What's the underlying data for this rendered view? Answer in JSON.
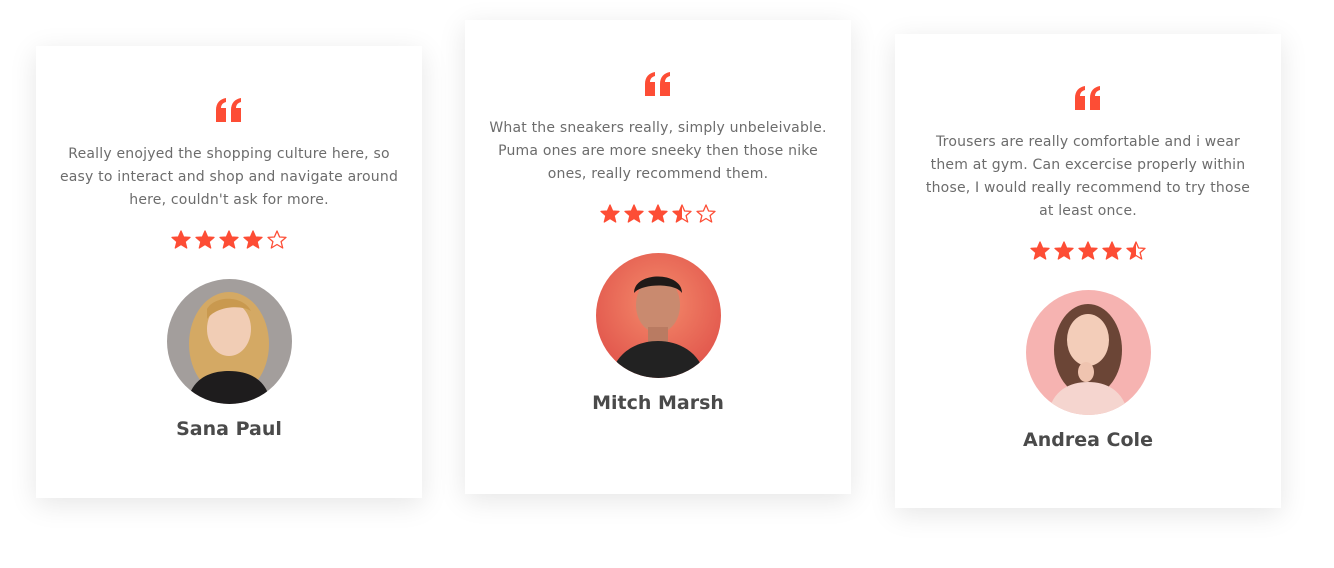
{
  "colors": {
    "accent": "#fd4d35",
    "text": "#6c6c6c",
    "name": "#4a4a4a",
    "card_bg": "#ffffff"
  },
  "testimonials": [
    {
      "quote_icon": "quote-icon",
      "text": "Really enojyed the shopping culture here, so easy to interact and shop and navigate around here, couldn't ask for more.",
      "rating": 4,
      "rating_max": 5,
      "name": "Sana Paul",
      "avatar": "woman-blonde-avatar"
    },
    {
      "quote_icon": "quote-icon",
      "text": "What the sneakers really, simply unbeleivable. Puma ones are more sneeky then those nike ones, really recommend them.",
      "rating": 3.5,
      "rating_max": 5,
      "name": "Mitch Marsh",
      "avatar": "man-dark-hair-avatar"
    },
    {
      "quote_icon": "quote-icon",
      "text": "Trousers are really comfortable and i wear them at gym. Can excercise properly within those, I would really recommend to try those at least once.",
      "rating": 4.5,
      "rating_max": 5,
      "name": "Andrea Cole",
      "avatar": "woman-brunette-avatar"
    }
  ]
}
